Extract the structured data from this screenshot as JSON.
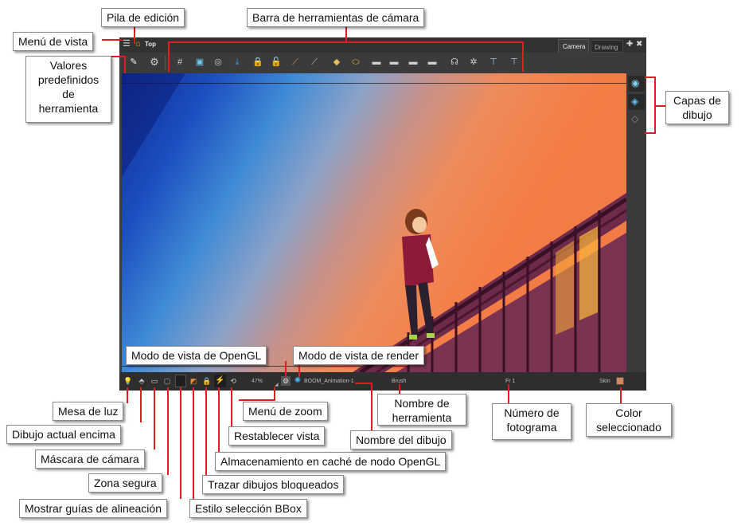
{
  "app": {
    "breadcrumb": "Top",
    "tabs": [
      {
        "label": "Camera"
      },
      {
        "label": "Drawing"
      }
    ],
    "add_symbol": "✚",
    "close_symbol": "✖",
    "status": {
      "zoom": "47%",
      "drawing_name": "BOOM_Animation-1",
      "tool_name": "Brush",
      "frame": "Fr 1",
      "color_label": "Skin",
      "color_value": "#c98c63"
    }
  },
  "callouts": {
    "pila_edicion": "Pila de edición",
    "barra_camara": "Barra de herramientas de cámara",
    "menu_vista": "Menú de vista",
    "valores_predefinidos": "Valores predefinidos de herramienta",
    "capas_dibujo": "Capas de dibujo",
    "modo_opengl": "Modo de vista de OpenGL",
    "modo_render": "Modo de vista de render",
    "mesa_luz": "Mesa de luz",
    "dibujo_encima": "Dibujo actual encima",
    "mascara_camara": "Máscara de cámara",
    "zona_segura": "Zona segura",
    "mostrar_guias": "Mostrar guías de alineación",
    "estilo_bbox": "Estilo selección BBox",
    "trazar_bloqueados": "Trazar dibujos bloqueados",
    "cache_opengl": "Almacenamiento en caché de nodo OpenGL",
    "restablecer_vista": "Restablecer vista",
    "menu_zoom": "Menú de zoom",
    "nombre_dibujo": "Nombre del dibujo",
    "nombre_herramienta": "Nombre de herramienta",
    "numero_fotograma": "Número de fotograma",
    "color_seleccionado": "Color seleccionado"
  }
}
